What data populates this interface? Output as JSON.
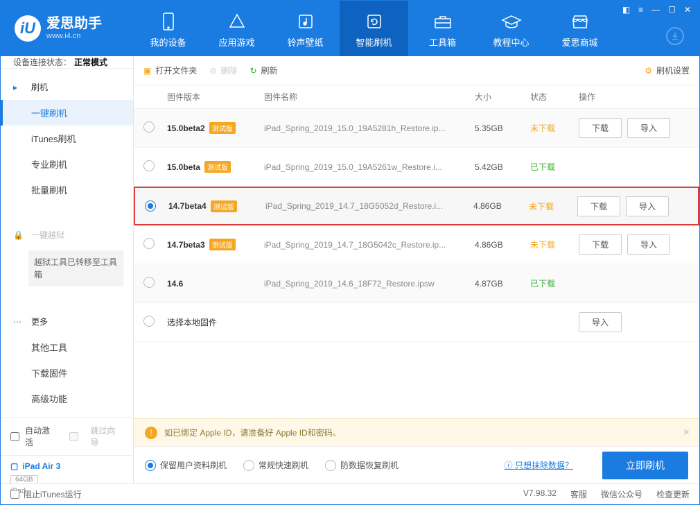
{
  "app": {
    "title": "爱思助手",
    "sub": "www.i4.cn"
  },
  "nav": [
    {
      "label": "我的设备"
    },
    {
      "label": "应用游戏"
    },
    {
      "label": "铃声壁纸"
    },
    {
      "label": "智能刷机"
    },
    {
      "label": "工具箱"
    },
    {
      "label": "教程中心"
    },
    {
      "label": "爱思商城"
    }
  ],
  "sidebar": {
    "conn_label": "设备连接状态：",
    "conn_mode": "正常模式",
    "sections": [
      {
        "head": "刷机",
        "items": [
          "一键刷机",
          "iTunes刷机",
          "专业刷机",
          "批量刷机"
        ]
      },
      {
        "head": "一键越狱",
        "notice": "越狱工具已转移至工具箱"
      },
      {
        "head": "更多",
        "items": [
          "其他工具",
          "下载固件",
          "高级功能"
        ]
      }
    ],
    "auto_activate": "自动激活",
    "skip_guide": "跳过向导",
    "device": {
      "name": "iPad Air 3",
      "storage": "64GB",
      "type": "iPad"
    }
  },
  "toolbar": {
    "open": "打开文件夹",
    "delete": "删除",
    "refresh": "刷新",
    "settings": "刷机设置"
  },
  "table": {
    "cols": {
      "ver": "固件版本",
      "name": "固件名称",
      "size": "大小",
      "status": "状态",
      "ops": "操作"
    },
    "rows": [
      {
        "ver": "15.0beta2",
        "beta": true,
        "name": "iPad_Spring_2019_15.0_19A5281h_Restore.ip...",
        "size": "5.35GB",
        "status": "未下载",
        "dl": true,
        "imp": true,
        "sel": false,
        "alt": true
      },
      {
        "ver": "15.0beta",
        "beta": true,
        "name": "iPad_Spring_2019_15.0_19A5261w_Restore.i...",
        "size": "5.42GB",
        "status": "已下载",
        "dl": false,
        "imp": false,
        "sel": false,
        "alt": false
      },
      {
        "ver": "14.7beta4",
        "beta": true,
        "name": "iPad_Spring_2019_14.7_18G5052d_Restore.i...",
        "size": "4.86GB",
        "status": "未下载",
        "dl": true,
        "imp": true,
        "sel": true,
        "hl": true
      },
      {
        "ver": "14.7beta3",
        "beta": true,
        "name": "iPad_Spring_2019_14.7_18G5042c_Restore.ip...",
        "size": "4.86GB",
        "status": "未下载",
        "dl": true,
        "imp": true,
        "sel": false,
        "alt": false
      },
      {
        "ver": "14.6",
        "beta": false,
        "name": "iPad_Spring_2019_14.6_18F72_Restore.ipsw",
        "size": "4.87GB",
        "status": "已下载",
        "dl": false,
        "imp": false,
        "sel": false,
        "alt": true
      }
    ],
    "local_row": "选择本地固件",
    "btn_dl": "下载",
    "btn_imp": "导入",
    "beta_label": "测试版"
  },
  "tip": "如已绑定 Apple ID，请准备好 Apple ID和密码。",
  "options": {
    "o1": "保留用户资料刷机",
    "o2": "常规快速刷机",
    "o3": "防数据恢复刷机",
    "link": "只想抹除数据？",
    "btn": "立即刷机"
  },
  "footer": {
    "block": "阻止iTunes运行",
    "ver": "V7.98.32",
    "svc": "客服",
    "wx": "微信公众号",
    "upd": "检查更新"
  }
}
